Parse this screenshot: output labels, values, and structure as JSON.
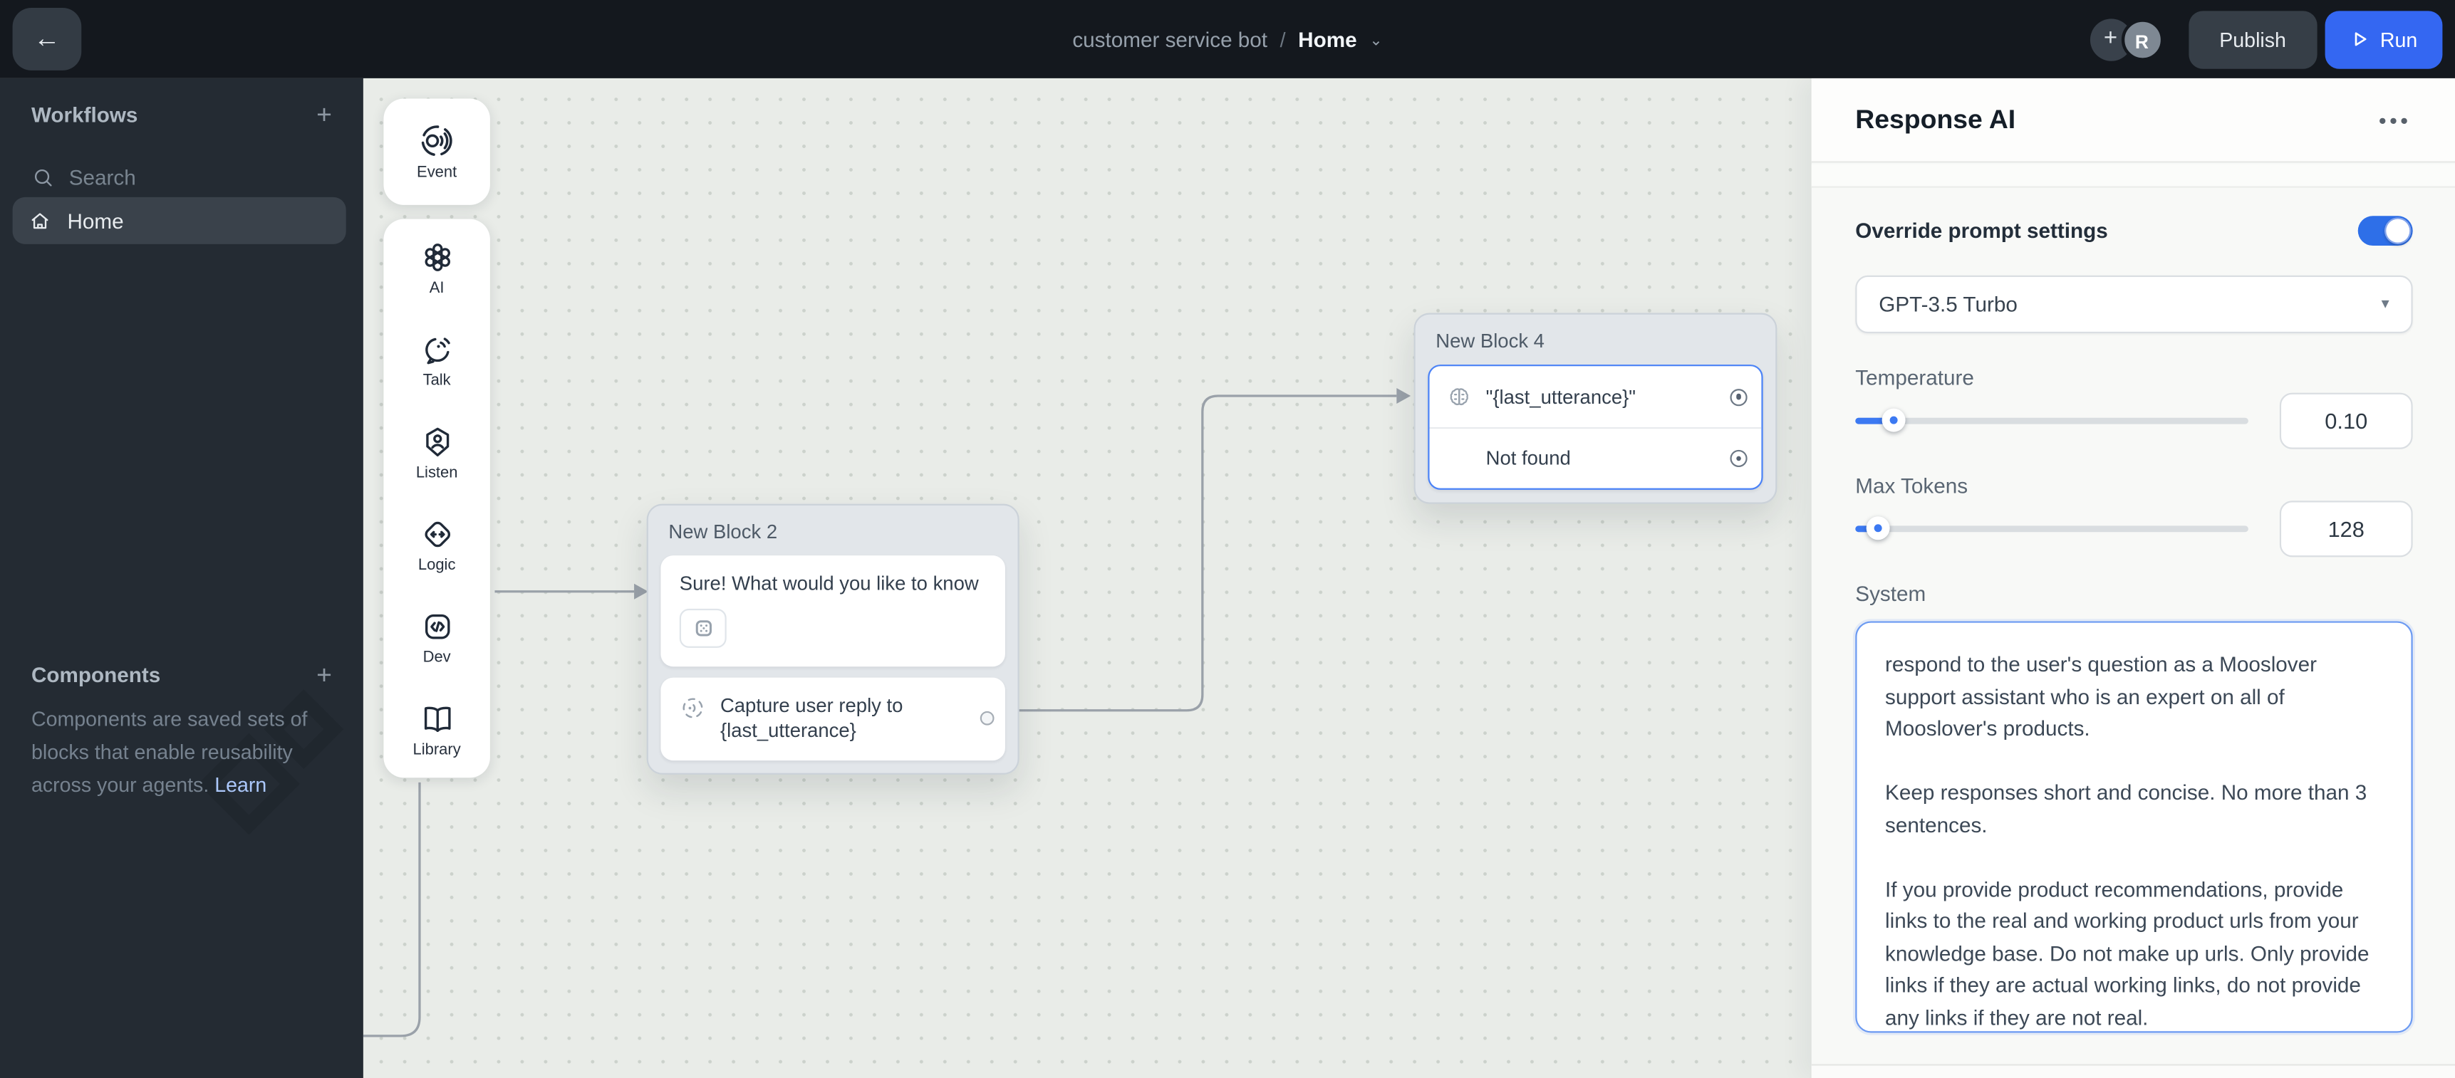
{
  "topbar": {
    "project": "customer service bot",
    "separator": "/",
    "page": "Home",
    "avatar_letter": "R",
    "publish_label": "Publish",
    "run_label": "Run"
  },
  "sidebar": {
    "workflows_title": "Workflows",
    "search_placeholder": "Search",
    "home_label": "Home",
    "components_title": "Components",
    "components_description": "Components are saved sets of blocks that enable reusability across your agents. ",
    "learn_link": "Learn"
  },
  "toolbar": {
    "event_label": "Event",
    "items": [
      {
        "label": "AI"
      },
      {
        "label": "Talk"
      },
      {
        "label": "Listen"
      },
      {
        "label": "Logic"
      },
      {
        "label": "Dev"
      },
      {
        "label": "Library"
      }
    ]
  },
  "canvas": {
    "block2": {
      "title": "New Block 2",
      "message": "Sure! What would you like to know",
      "capture_text": "Capture user reply to {last_utterance}"
    },
    "block4": {
      "title": "New Block 4",
      "intent_text": "\"{last_utterance}\"",
      "not_found_text": "Not found"
    }
  },
  "panel": {
    "title": "Response AI",
    "override_label": "Override prompt settings",
    "override_on": true,
    "model_value": "GPT-3.5 Turbo",
    "temperature_label": "Temperature",
    "temperature_value": "0.10",
    "max_tokens_label": "Max Tokens",
    "max_tokens_value": "128",
    "system_label": "System",
    "system_text": "respond to the user's question as a Mooslover support assistant who is an expert on all of Mooslover's products.\n\nKeep responses short and concise. No more than 3 sentences.\n\nIf you provide product recommendations, provide links to the real and working product urls from your knowledge base. Do not make up urls. Only provide links if they are actual working links, do not provide any links if they are not real."
  },
  "icons": {
    "plus": "+",
    "back_arrow": "←",
    "caret_down": "⌄",
    "select_caret": "▾",
    "more_menu": "•••"
  },
  "colors": {
    "topbar_bg": "#14181e",
    "sidebar_bg": "#242b33",
    "canvas_bg": "#e9ece8",
    "accent_blue": "#3467f2",
    "toggle_blue": "#2e6fe8",
    "selected_border": "#4a82f7"
  }
}
